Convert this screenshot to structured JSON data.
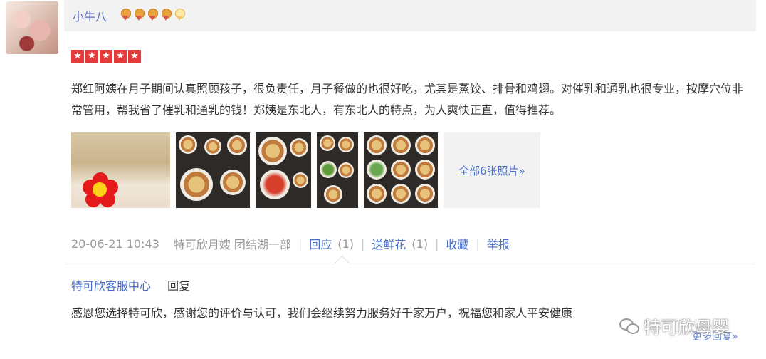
{
  "user": {
    "name": "小牛八",
    "medals": [
      "medal-full",
      "medal-full",
      "medal-full",
      "medal-full",
      "medal-half"
    ]
  },
  "rating": {
    "stars": 5,
    "star_glyph": "★"
  },
  "review": {
    "text": "郑红阿姨在月子期间认真照顾孩子，很负责任，月子餐做的也很好吃，尤其是蒸饺、排骨和鸡翅。对催乳和通乳也很专业，按摩穴位非常管用，帮我省了催乳和通乳的钱！郑姨是东北人，有东北人的特点，为人爽快正直，值得推荐。",
    "all_photos_label": "全部6张照片»"
  },
  "meta": {
    "datetime": "20-06-21 10:43",
    "source": "特可欣月嫂 团结湖一部",
    "reply_label": "回应",
    "reply_count": "(1)",
    "flower_label": "送鲜花",
    "flower_count": "(1)",
    "favorite_label": "收藏",
    "report_label": "举报",
    "separator": "|"
  },
  "reply": {
    "author": "特可欣客服中心",
    "label": "回复",
    "text": "感恩您选择特可欣，感谢您的评价与认可，我们会继续努力服务好千家万户，祝福您和家人平安健康",
    "more_label": "更多回复»"
  },
  "watermark": {
    "text": "特可欣母婴"
  },
  "colors": {
    "link": "#4a6fc9",
    "username": "#5a6fbf",
    "star": "#e43a3a",
    "header_bg": "#f2f2f2"
  }
}
